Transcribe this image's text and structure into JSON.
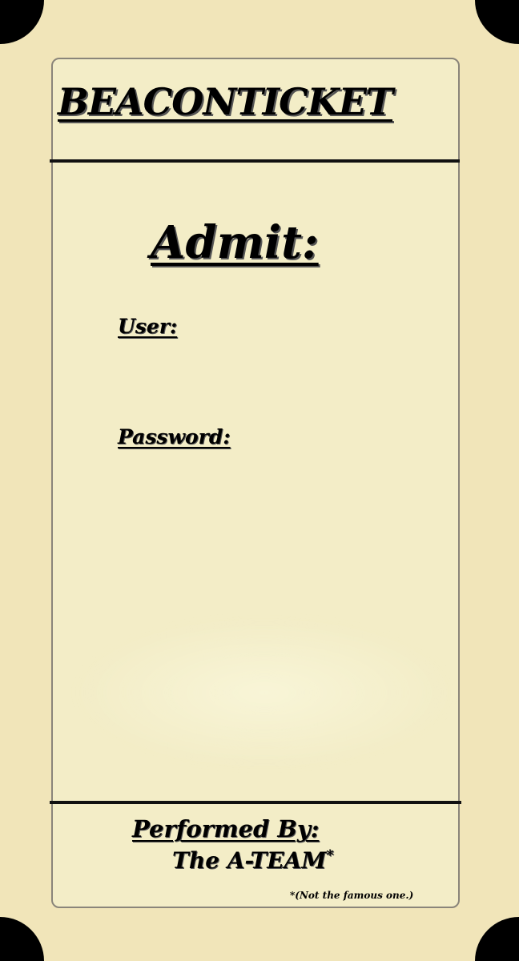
{
  "ticket": {
    "brand": "BEACONTICKET",
    "admit": "Admit:",
    "fields": {
      "user_label": "User:",
      "password_label": "Password:"
    },
    "credits": {
      "performed_by": "Performed By:",
      "performer": "The A-TEAM",
      "performer_mark": "*",
      "footnote": "*(Not the famous one.)"
    },
    "colors": {
      "outer_background": "#000000",
      "ticket_paper": "#f1e5b9",
      "inner_panel": "#f3edc7",
      "ink": "#000000"
    }
  }
}
